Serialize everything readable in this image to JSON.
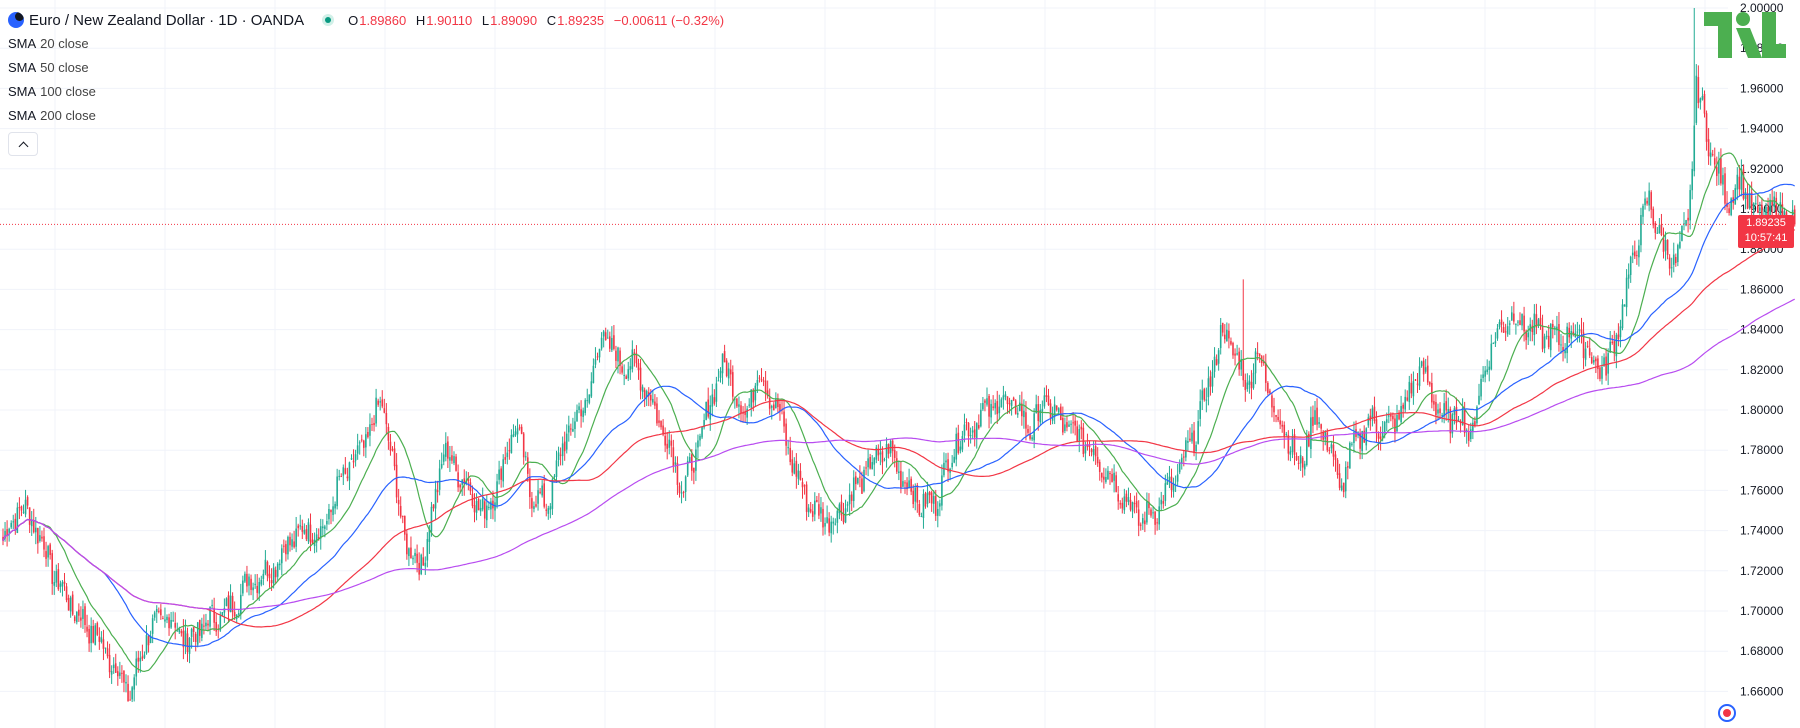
{
  "header": {
    "title": "Euro / New Zealand Dollar · 1D · OANDA",
    "ohlc": {
      "o_label": "O",
      "o": "1.89860",
      "h_label": "H",
      "h": "1.90110",
      "l_label": "L",
      "l": "1.89090",
      "c_label": "C",
      "c": "1.89235",
      "change": "−0.00611 (−0.32%)"
    }
  },
  "indicators": [
    {
      "name": "SMA",
      "param": "20 close",
      "color": "#4caf50"
    },
    {
      "name": "SMA",
      "param": "50 close",
      "color": "#2962ff"
    },
    {
      "name": "SMA",
      "param": "100 close",
      "color": "#f23645"
    },
    {
      "name": "SMA",
      "param": "200 close",
      "color": "#b84cf0"
    }
  ],
  "price_label": {
    "price": "1.89235",
    "countdown": "10:57:41"
  },
  "logo_text": "TV",
  "colors": {
    "up": "#22ab94",
    "down": "#f23645",
    "grid": "#f0f3fa",
    "axis_text": "#131722"
  },
  "chart_data": {
    "type": "candlestick",
    "instrument": "Euro / New Zealand Dollar",
    "timeframe": "1D",
    "y_ticks": [
      1.66,
      1.68,
      1.7,
      1.72,
      1.74,
      1.76,
      1.78,
      1.8,
      1.82,
      1.84,
      1.86,
      1.88,
      1.9,
      1.92,
      1.94,
      1.96,
      1.98,
      2.0
    ],
    "ylim": [
      1.645,
      2.0
    ],
    "last_price": 1.89235,
    "keypoints": [
      [
        0,
        1.735
      ],
      [
        8,
        1.752
      ],
      [
        15,
        1.745
      ],
      [
        25,
        1.718
      ],
      [
        35,
        1.7
      ],
      [
        45,
        1.688
      ],
      [
        55,
        1.672
      ],
      [
        62,
        1.658
      ],
      [
        70,
        1.688
      ],
      [
        80,
        1.698
      ],
      [
        90,
        1.685
      ],
      [
        100,
        1.695
      ],
      [
        110,
        1.7
      ],
      [
        120,
        1.715
      ],
      [
        130,
        1.72
      ],
      [
        140,
        1.735
      ],
      [
        150,
        1.742
      ],
      [
        155,
        1.738
      ],
      [
        165,
        1.765
      ],
      [
        175,
        1.78
      ],
      [
        185,
        1.805
      ],
      [
        192,
        1.76
      ],
      [
        198,
        1.728
      ],
      [
        205,
        1.725
      ],
      [
        215,
        1.78
      ],
      [
        225,
        1.765
      ],
      [
        235,
        1.748
      ],
      [
        245,
        1.775
      ],
      [
        250,
        1.795
      ],
      [
        257,
        1.76
      ],
      [
        265,
        1.752
      ],
      [
        275,
        1.788
      ],
      [
        285,
        1.805
      ],
      [
        292,
        1.838
      ],
      [
        300,
        1.825
      ],
      [
        310,
        1.82
      ],
      [
        318,
        1.8
      ],
      [
        326,
        1.78
      ],
      [
        332,
        1.76
      ],
      [
        340,
        1.785
      ],
      [
        350,
        1.822
      ],
      [
        356,
        1.815
      ],
      [
        362,
        1.795
      ],
      [
        368,
        1.82
      ],
      [
        378,
        1.8
      ],
      [
        386,
        1.77
      ],
      [
        395,
        1.75
      ],
      [
        405,
        1.745
      ],
      [
        415,
        1.76
      ],
      [
        425,
        1.775
      ],
      [
        432,
        1.78
      ],
      [
        440,
        1.765
      ],
      [
        448,
        1.752
      ],
      [
        455,
        1.755
      ],
      [
        465,
        1.785
      ],
      [
        472,
        1.792
      ],
      [
        480,
        1.8
      ],
      [
        488,
        1.805
      ],
      [
        495,
        1.8
      ],
      [
        502,
        1.79
      ],
      [
        508,
        1.805
      ],
      [
        515,
        1.795
      ],
      [
        520,
        1.79
      ],
      [
        528,
        1.785
      ],
      [
        535,
        1.775
      ],
      [
        545,
        1.76
      ],
      [
        555,
        1.745
      ],
      [
        562,
        1.75
      ],
      [
        572,
        1.765
      ],
      [
        582,
        1.79
      ],
      [
        590,
        1.82
      ],
      [
        595,
        1.84
      ],
      [
        600,
        1.83
      ],
      [
        607,
        1.812
      ],
      [
        612,
        1.83
      ],
      [
        620,
        1.8
      ],
      [
        626,
        1.79
      ],
      [
        632,
        1.77
      ],
      [
        640,
        1.798
      ],
      [
        648,
        1.78
      ],
      [
        652,
        1.76
      ],
      [
        660,
        1.785
      ],
      [
        668,
        1.795
      ],
      [
        675,
        1.79
      ],
      [
        683,
        1.8
      ],
      [
        690,
        1.82
      ],
      [
        696,
        1.812
      ],
      [
        702,
        1.795
      ],
      [
        710,
        1.798
      ],
      [
        716,
        1.788
      ],
      [
        725,
        1.83
      ],
      [
        735,
        1.848
      ],
      [
        745,
        1.84
      ],
      [
        752,
        1.837
      ],
      [
        760,
        1.835
      ],
      [
        768,
        1.84
      ],
      [
        775,
        1.825
      ],
      [
        782,
        1.82
      ],
      [
        790,
        1.85
      ],
      [
        797,
        1.885
      ],
      [
        803,
        1.905
      ],
      [
        810,
        1.88
      ],
      [
        816,
        1.875
      ],
      [
        822,
        1.892
      ],
      [
        826,
        1.96
      ],
      [
        830,
        1.945
      ],
      [
        835,
        1.92
      ],
      [
        842,
        1.905
      ],
      [
        848,
        1.915
      ],
      [
        855,
        1.895
      ],
      [
        860,
        1.898
      ],
      [
        868,
        1.9
      ],
      [
        874,
        1.892
      ]
    ],
    "spikes": [
      {
        "i": 825,
        "high": 2.0
      },
      {
        "i": 605,
        "high": 1.865
      }
    ],
    "sma_periods": [
      20,
      50,
      100,
      200
    ]
  }
}
